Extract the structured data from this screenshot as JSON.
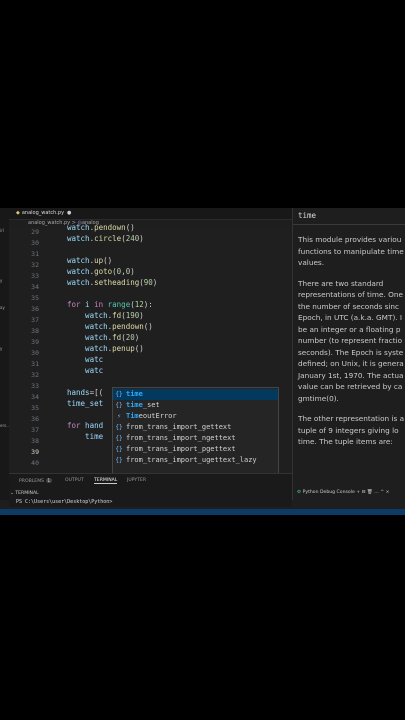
{
  "tab": {
    "filename": "analog_watch.py"
  },
  "breadcrumb": {
    "file": "analog_watch.py",
    "separator": ">",
    "symbol": "analog"
  },
  "activity": [
    "irl",
    "y",
    "ay",
    "y",
    "ers..."
  ],
  "lines": [
    {
      "n": "29",
      "cur": false
    },
    {
      "n": "30",
      "cur": false
    },
    {
      "n": "31",
      "cur": false
    },
    {
      "n": "32",
      "cur": false
    },
    {
      "n": "33",
      "cur": false
    },
    {
      "n": "34",
      "cur": false
    },
    {
      "n": "35",
      "cur": false
    },
    {
      "n": "36",
      "cur": false
    },
    {
      "n": "37",
      "cur": false
    },
    {
      "n": "38",
      "cur": false
    },
    {
      "n": "39",
      "cur": false
    },
    {
      "n": "30",
      "cur": false
    },
    {
      "n": "31",
      "cur": false
    },
    {
      "n": "32",
      "cur": false
    },
    {
      "n": "33",
      "cur": false
    },
    {
      "n": "34",
      "cur": false
    },
    {
      "n": "35",
      "cur": false
    },
    {
      "n": "36",
      "cur": false
    },
    {
      "n": "37",
      "cur": false
    },
    {
      "n": "38",
      "cur": false
    },
    {
      "n": "39",
      "cur": true
    },
    {
      "n": "40",
      "cur": false
    }
  ],
  "code": [
    {
      "segs": [
        {
          "t": "watch",
          "c": ""
        },
        {
          "t": ".",
          "c": "pl"
        },
        {
          "t": "pendown",
          "c": "fn"
        },
        {
          "t": "()",
          "c": "pl"
        }
      ]
    },
    {
      "segs": [
        {
          "t": "watch",
          "c": ""
        },
        {
          "t": ".",
          "c": "pl"
        },
        {
          "t": "circle",
          "c": "fn"
        },
        {
          "t": "(",
          "c": "pl"
        },
        {
          "t": "240",
          "c": "num"
        },
        {
          "t": ")",
          "c": "pl"
        }
      ]
    },
    {
      "segs": []
    },
    {
      "segs": [
        {
          "t": "watch",
          "c": ""
        },
        {
          "t": ".",
          "c": "pl"
        },
        {
          "t": "up",
          "c": "fn"
        },
        {
          "t": "()",
          "c": "pl"
        }
      ]
    },
    {
      "segs": [
        {
          "t": "watch",
          "c": ""
        },
        {
          "t": ".",
          "c": "pl"
        },
        {
          "t": "goto",
          "c": "fn"
        },
        {
          "t": "(",
          "c": "pl"
        },
        {
          "t": "0",
          "c": "num"
        },
        {
          "t": ",",
          "c": "pl"
        },
        {
          "t": "0",
          "c": "num"
        },
        {
          "t": ")",
          "c": "pl"
        }
      ]
    },
    {
      "segs": [
        {
          "t": "watch",
          "c": ""
        },
        {
          "t": ".",
          "c": "pl"
        },
        {
          "t": "setheading",
          "c": "fn"
        },
        {
          "t": "(",
          "c": "pl"
        },
        {
          "t": "90",
          "c": "num"
        },
        {
          "t": ")",
          "c": "pl"
        }
      ]
    },
    {
      "segs": []
    },
    {
      "segs": [
        {
          "t": "for",
          "c": "kw"
        },
        {
          "t": " i ",
          "c": ""
        },
        {
          "t": "in",
          "c": "kw"
        },
        {
          "t": " ",
          "c": ""
        },
        {
          "t": "range",
          "c": "bi"
        },
        {
          "t": "(",
          "c": "pl"
        },
        {
          "t": "12",
          "c": "num"
        },
        {
          "t": "):",
          "c": "pl"
        }
      ]
    },
    {
      "segs": [
        {
          "t": "    watch",
          "c": ""
        },
        {
          "t": ".",
          "c": "pl"
        },
        {
          "t": "fd",
          "c": "fn"
        },
        {
          "t": "(",
          "c": "pl"
        },
        {
          "t": "190",
          "c": "num"
        },
        {
          "t": ")",
          "c": "pl"
        }
      ]
    },
    {
      "segs": [
        {
          "t": "    watch",
          "c": ""
        },
        {
          "t": ".",
          "c": "pl"
        },
        {
          "t": "pendown",
          "c": "fn"
        },
        {
          "t": "()",
          "c": "pl"
        }
      ]
    },
    {
      "segs": [
        {
          "t": "    watch",
          "c": ""
        },
        {
          "t": ".",
          "c": "pl"
        },
        {
          "t": "fd",
          "c": "fn"
        },
        {
          "t": "(",
          "c": "pl"
        },
        {
          "t": "20",
          "c": "num"
        },
        {
          "t": ")",
          "c": "pl"
        }
      ]
    },
    {
      "segs": [
        {
          "t": "    watch",
          "c": ""
        },
        {
          "t": ".",
          "c": "pl"
        },
        {
          "t": "penup",
          "c": "fn"
        },
        {
          "t": "()",
          "c": "pl"
        }
      ]
    },
    {
      "segs": [
        {
          "t": "    watc",
          "c": ""
        }
      ]
    },
    {
      "segs": [
        {
          "t": "    watc",
          "c": ""
        }
      ]
    },
    {
      "segs": [
        {
          "t": "",
          "c": ""
        }
      ]
    },
    {
      "segs": [
        {
          "t": "hands",
          "c": ""
        },
        {
          "t": "=[(",
          "c": "pl"
        }
      ]
    },
    {
      "segs": [
        {
          "t": "time_set",
          "c": ""
        }
      ]
    },
    {
      "segs": []
    },
    {
      "segs": [
        {
          "t": "for",
          "c": "kw"
        },
        {
          "t": " hand",
          "c": ""
        }
      ]
    },
    {
      "segs": [
        {
          "t": "    time",
          "c": ""
        }
      ]
    },
    {
      "segs": []
    }
  ],
  "suggestions": [
    {
      "match": "time",
      "rest": "",
      "selected": true
    },
    {
      "match": "time",
      "rest": "_set",
      "selected": false
    },
    {
      "match": "Tim",
      "rest": "eoutError",
      "selected": false
    },
    {
      "match": "",
      "rest": "from_trans_import_gettext",
      "selected": false
    },
    {
      "match": "",
      "rest": "from_trans_import_ngettext",
      "selected": false
    },
    {
      "match": "",
      "rest": "from_trans_import_pgettext",
      "selected": false
    },
    {
      "match": "",
      "rest": "from_trans_import_ugettext_lazy",
      "selected": false
    }
  ],
  "doc": {
    "title": "time",
    "p1": [
      "This module provides variou",
      "functions to manipulate time",
      "values."
    ],
    "p2": [
      "There are two standard",
      "representations of time. One",
      "the number of seconds sinc",
      "Epoch, in UTC (a.k.a. GMT). I",
      "be an integer or a floating p",
      "number (to represent fractio",
      "seconds). The Epoch is syste",
      "defined; on Unix, it is genera",
      "January 1st, 1970. The actua",
      "value can be retrieved by ca",
      "gmtime(0)."
    ],
    "p3": [
      "The other representation is a",
      "tuple of 9 integers giving lo",
      "time. The tuple items are:"
    ]
  },
  "panel": {
    "tabs": [
      "PROBLEMS",
      "OUTPUT",
      "TERMINAL",
      "JUPYTER"
    ],
    "problems_count": "1",
    "terminal_title": "TERMINAL",
    "terminal_right": "Python Debug Console",
    "prompt": "PS C:\\Users\\user\\Desktop\\Python>"
  }
}
